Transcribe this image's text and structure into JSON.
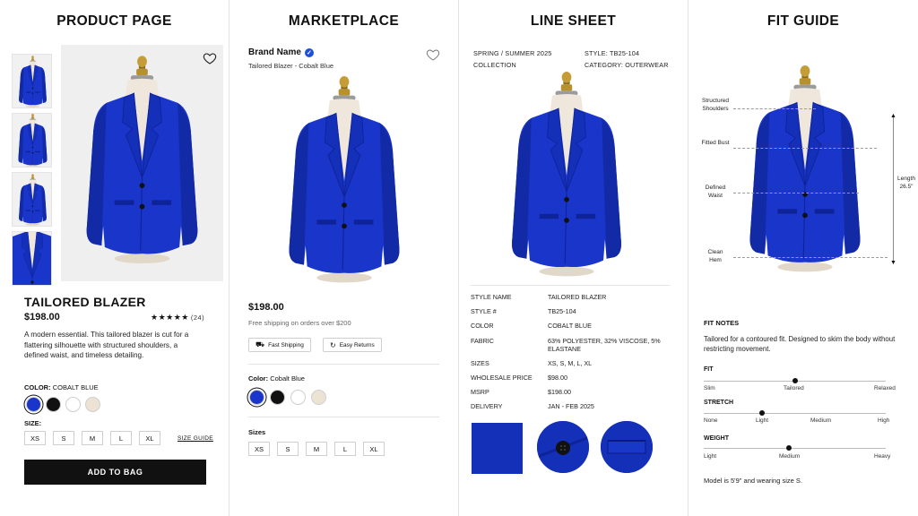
{
  "colors": {
    "cobalt": "#1a35c9",
    "cobalt_dark": "#0f2399",
    "black": "#111111",
    "white": "#ffffff",
    "cream": "#ede3d4",
    "mannequin_skin": "#efe7dc",
    "brass": "#b8912f"
  },
  "product_page": {
    "title": "PRODUCT PAGE",
    "product_name": "TAILORED BLAZER",
    "price": "$198.00",
    "rating_stars": "★★★★★",
    "rating_count": "(24)",
    "description": "A modern essential. This tailored blazer is cut for a flattering silhouette with structured shoulders, a defined waist, and timeless detailing.",
    "color_label": "COLOR:",
    "color_value": "COBALT BLUE",
    "size_label": "SIZE:",
    "sizes": [
      "XS",
      "S",
      "M",
      "L",
      "XL"
    ],
    "size_guide": "SIZE GUIDE",
    "add_to_bag": "ADD TO BAG",
    "wishlist_icon": "heart-icon"
  },
  "marketplace": {
    "title": "MARKETPLACE",
    "brand_name": "Brand Name",
    "product_subtitle": "Tailored Blazer - Cobalt Blue",
    "price": "$198.00",
    "shipping_note": "Free shipping on orders over $200",
    "badges": [
      {
        "icon": "truck-icon",
        "label": "Fast Shipping"
      },
      {
        "icon": "return-icon",
        "label": "Easy Returns"
      }
    ],
    "color_label": "Color:",
    "color_value": "Cobalt Blue",
    "sizes_label": "Sizes",
    "sizes": [
      "XS",
      "S",
      "M",
      "L",
      "XL"
    ]
  },
  "line_sheet": {
    "title": "LINE SHEET",
    "season_line1": "SPRING / SUMMER 2025",
    "season_line2": "COLLECTION",
    "style_meta": "STYLE: TB25-104",
    "category_meta": "CATEGORY: OUTERWEAR",
    "specs": [
      {
        "k": "STYLE NAME",
        "v": "TAILORED BLAZER"
      },
      {
        "k": "STYLE #",
        "v": "TB25-104"
      },
      {
        "k": "COLOR",
        "v": "COBALT BLUE"
      },
      {
        "k": "FABRIC",
        "v": "63% POLYESTER, 32% VISCOSE, 5% ELASTANE"
      },
      {
        "k": "SIZES",
        "v": "XS, S, M, L, XL"
      },
      {
        "k": "WHOLESALE PRICE",
        "v": "$98.00"
      },
      {
        "k": "MSRP",
        "v": "$198.00"
      },
      {
        "k": "DELIVERY",
        "v": "JAN - FEB 2025"
      }
    ]
  },
  "fit_guide": {
    "title": "FIT GUIDE",
    "callouts": {
      "shoulders": "Structured Shoulders",
      "bust": "Fitted Bust",
      "waist": "Defined Waist",
      "hem": "Clean Hem",
      "length": "Length 26.5\""
    },
    "fit_notes_heading": "FIT NOTES",
    "fit_notes": "Tailored for a contoured fit. Designed to skim the body without restricting movement.",
    "scales": [
      {
        "name": "FIT",
        "value": 0.5,
        "labels": [
          "Slim",
          "Tailored",
          "Relaxed"
        ]
      },
      {
        "name": "STRETCH",
        "value": 0.32,
        "labels": [
          "None",
          "Light",
          "Medium",
          "High"
        ]
      },
      {
        "name": "WEIGHT",
        "value": 0.47,
        "labels": [
          "Light",
          "Medium",
          "Heavy"
        ]
      }
    ],
    "model_note": "Model is 5'9\" and wearing size S."
  }
}
